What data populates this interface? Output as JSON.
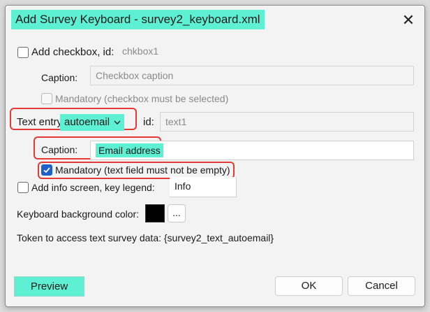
{
  "window": {
    "title": "Add Survey Keyboard - survey2_keyboard.xml",
    "close_symbol": "✕"
  },
  "checkbox_section": {
    "add_checkbox_label": "Add checkbox, id:",
    "add_checkbox_checked": false,
    "id_value": "chkbox1",
    "caption_label": "Caption:",
    "caption_value": "Checkbox caption",
    "mandatory_label": "Mandatory (checkbox must be selected)",
    "mandatory_checked": false
  },
  "text_entry": {
    "label": "Text entry:",
    "selected_option": "autoemail",
    "id_label": "id:",
    "id_value": "text1",
    "caption_label": "Caption:",
    "caption_value": "Email address",
    "mandatory_label": "Mandatory (text field must not be empty)",
    "mandatory_checked": true
  },
  "info_screen": {
    "label": "Add info screen, key legend:",
    "checked": false,
    "value": "Info"
  },
  "background": {
    "label": "Keyboard background color:",
    "color": "#000000",
    "dots_label": "..."
  },
  "token": {
    "text": "Token to access text survey data: {survey2_text_autoemail}"
  },
  "buttons": {
    "preview": "Preview",
    "ok": "OK",
    "cancel": "Cancel"
  },
  "colors": {
    "highlight": "#5ef0d2",
    "annotation_red": "#e53935",
    "checkbox_blue": "#1e5fc9"
  }
}
